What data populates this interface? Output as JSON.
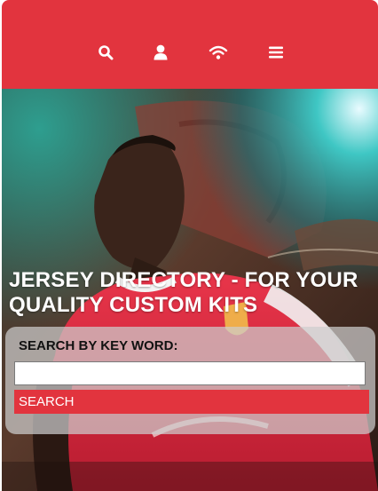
{
  "colors": {
    "brand": "#e2343e",
    "header_icon": "#ffffff"
  },
  "header": {
    "icons": [
      "search-icon",
      "user-icon",
      "wifi-icon",
      "menu-icon"
    ]
  },
  "hero": {
    "headline": "JERSEY DIRECTORY - FOR YOUR QUALITY CUSTOM KITS",
    "image": "footballer in red and white kit"
  },
  "search": {
    "label": "SEARCH BY KEY WORD:",
    "input_value": "",
    "placeholder": "",
    "button_label": "SEARCH"
  }
}
